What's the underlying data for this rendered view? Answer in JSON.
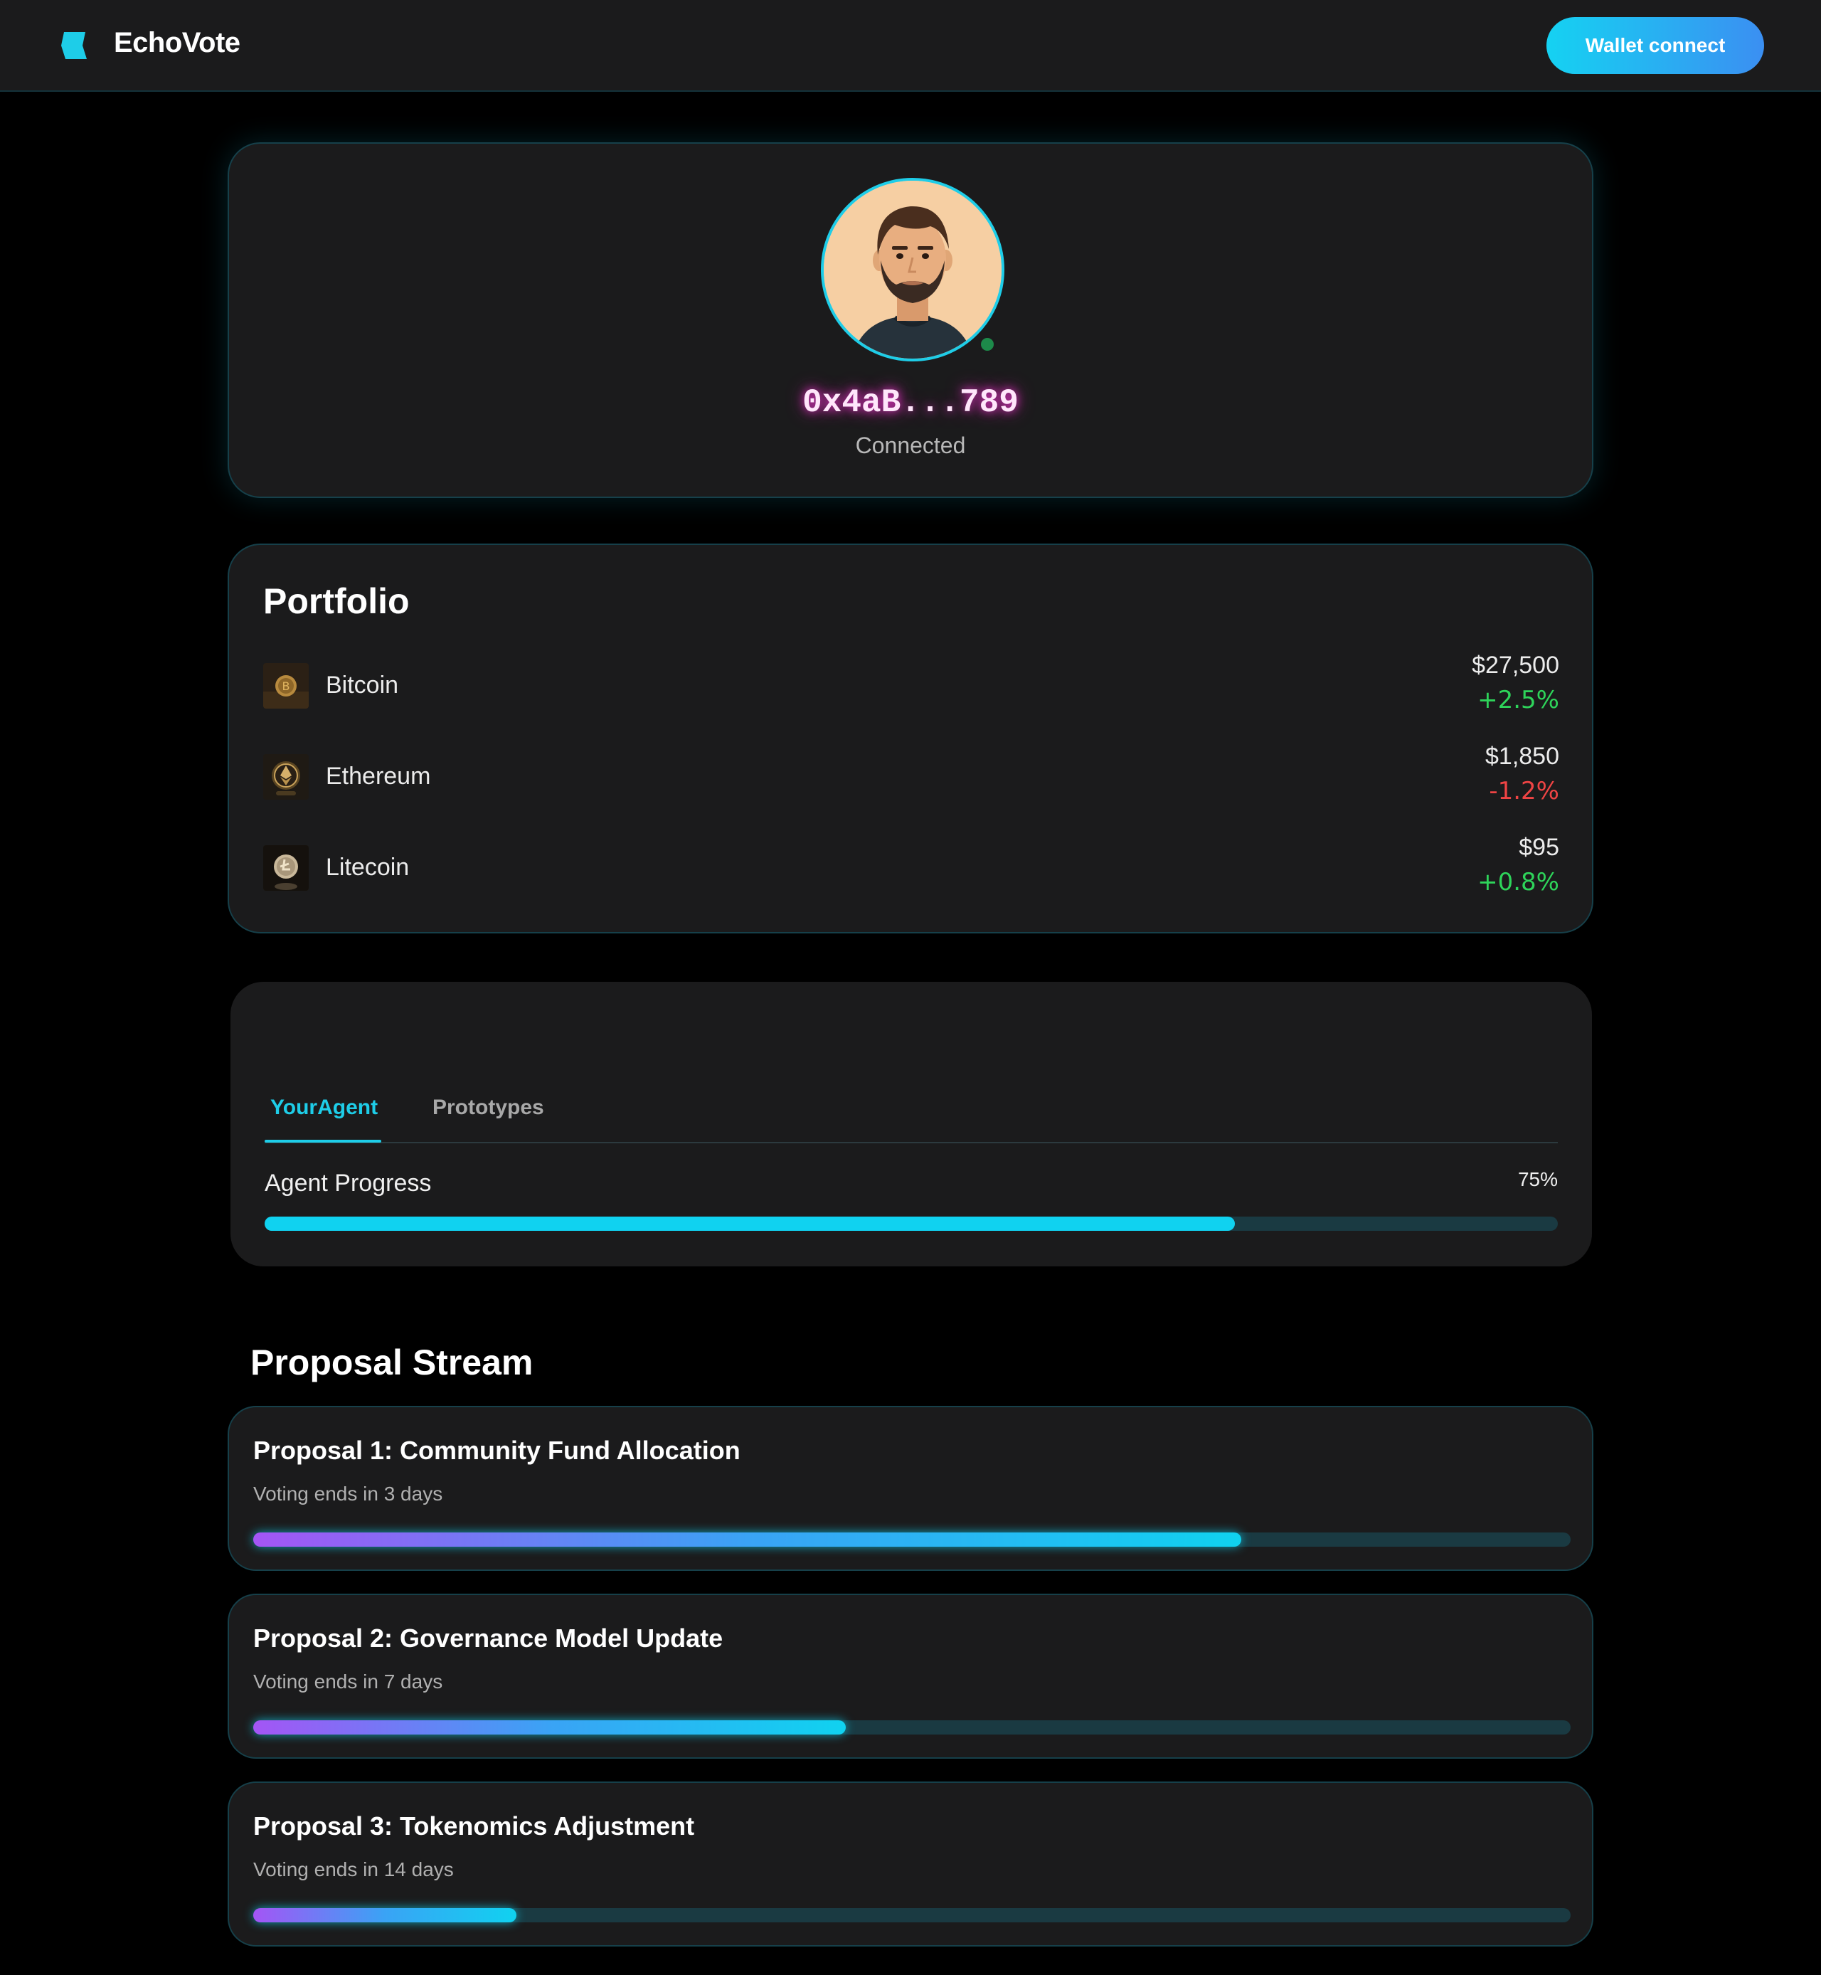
{
  "header": {
    "brand": "EchoVote",
    "wallet_button": "Wallet connect"
  },
  "profile": {
    "address": "0x4aB...789",
    "status": "Connected",
    "online": true
  },
  "portfolio": {
    "title": "Portfolio",
    "assets": [
      {
        "name": "Bitcoin",
        "price": "$27,500",
        "change": "+2.5%",
        "direction": "up"
      },
      {
        "name": "Ethereum",
        "price": "$1,850",
        "change": "-1.2%",
        "direction": "down"
      },
      {
        "name": "Litecoin",
        "price": "$95",
        "change": "+0.8%",
        "direction": "up"
      }
    ]
  },
  "agent": {
    "tabs": [
      {
        "label": "YourAgent",
        "active": true
      },
      {
        "label": "Prototypes",
        "active": false
      }
    ],
    "progress_label": "Agent Progress",
    "progress_value": "75%",
    "progress_fraction": 0.75
  },
  "proposals": {
    "title": "Proposal Stream",
    "items": [
      {
        "title": "Proposal 1: Community Fund Allocation",
        "deadline": "Voting ends in 3 days",
        "progress": 0.75
      },
      {
        "title": "Proposal 2: Governance Model Update",
        "deadline": "Voting ends in 7 days",
        "progress": 0.45
      },
      {
        "title": "Proposal 3: Tokenomics Adjustment",
        "deadline": "Voting ends in 14 days",
        "progress": 0.2
      }
    ]
  },
  "colors": {
    "accent": "#1ecde8",
    "background": "#000000",
    "card": "#1b1b1c",
    "positive": "#2ed45a",
    "negative": "#ef4444",
    "address_glow": "#d234b8"
  },
  "icons": {
    "logo": "echovote-logo-icon",
    "status": "online-status-dot",
    "assets": [
      "bitcoin-coin-icon",
      "ethereum-coin-icon",
      "litecoin-coin-icon"
    ]
  }
}
